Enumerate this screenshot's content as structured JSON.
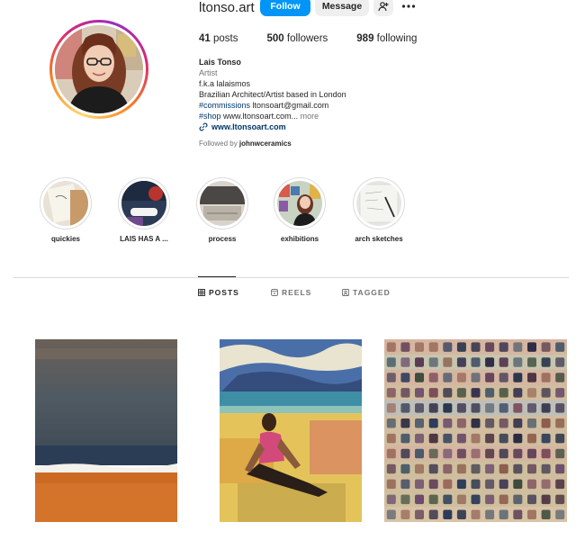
{
  "profile": {
    "username": "ltonso.art",
    "follow_label": "Follow",
    "message_label": "Message",
    "stats": [
      {
        "count": "41",
        "label": "posts"
      },
      {
        "count": "500",
        "label": "followers"
      },
      {
        "count": "989",
        "label": "following"
      }
    ],
    "bio": {
      "name": "Lais Tonso",
      "category": "Artist",
      "line1": "f.k.a lalaismos",
      "line2": "Brazilian Architect/Artist based in London",
      "hashtag1": "#commissions",
      "email": "ltonsoart@gmail.com",
      "hashtag2": "#shop",
      "shop_text": "www.ltonsoart.com...",
      "more": "more",
      "link": "www.ltonsoart.com"
    },
    "followed_by_prefix": "Followed by",
    "followed_by_user": "johnwceramics"
  },
  "highlights": [
    {
      "label": "quickies"
    },
    {
      "label": "LAIS HAS A ..."
    },
    {
      "label": "process"
    },
    {
      "label": "exhibitions"
    },
    {
      "label": "arch sketches"
    }
  ],
  "tabs": [
    {
      "label": "POSTS",
      "active": true
    },
    {
      "label": "REELS",
      "active": false
    },
    {
      "label": "TAGGED",
      "active": false
    }
  ],
  "colors": {
    "accent": "#0095f6",
    "text": "#262626",
    "muted": "#737373",
    "link": "#00376b",
    "divider": "#dbdbdb"
  },
  "icons": {
    "add_user": "person-plus-icon",
    "more": "more-horizontal-icon",
    "link": "link-icon",
    "posts_tab": "grid-icon",
    "reels_tab": "reels-icon",
    "tagged_tab": "tagged-icon"
  }
}
